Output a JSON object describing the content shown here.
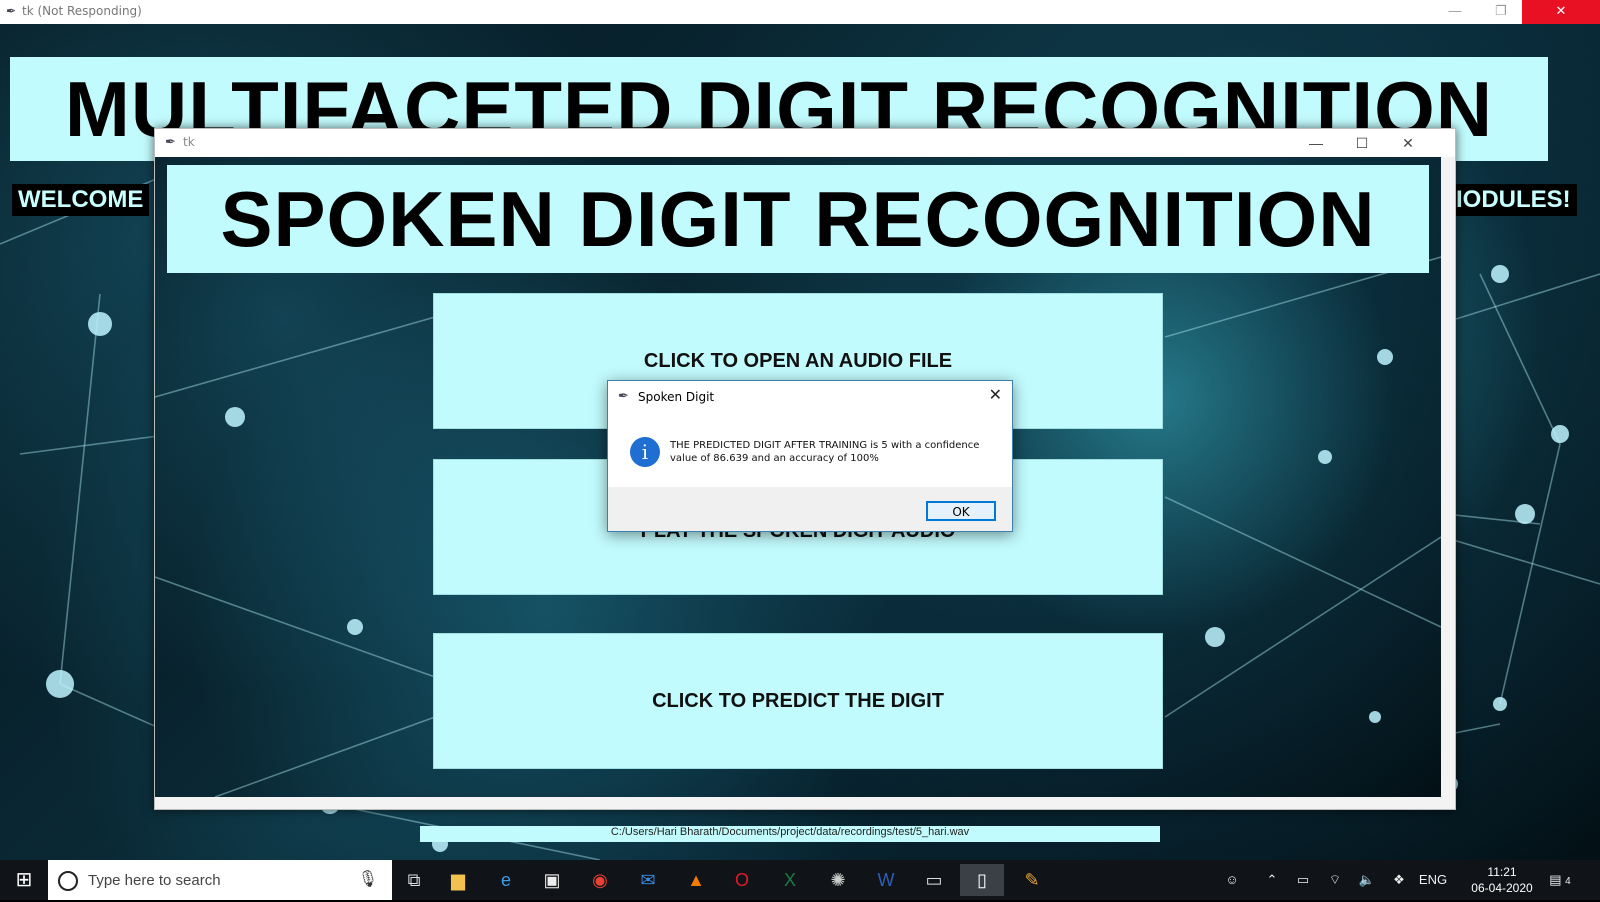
{
  "main_window": {
    "title": "tk (Not Responding)",
    "heading": "MULTIFACETED DIGIT RECOGNITION",
    "welcome_left": "WELCOME",
    "welcome_right": "IODULES!",
    "hidden_path": "C:/Users/Hari Bharath/Documents/project/data/recordings/test/5_hari.wav"
  },
  "tk_window": {
    "title": "tk",
    "heading": "SPOKEN DIGIT RECOGNITION",
    "buttons": {
      "open": "CLICK TO OPEN AN AUDIO FILE",
      "play": "PLAY THE SPOKEN DIGIT AUDIO",
      "predict": "CLICK TO PREDICT THE DIGIT"
    }
  },
  "dialog": {
    "title": "Spoken Digit",
    "message": "THE PREDICTED DIGIT AFTER TRAINING is 5 with a confidence value of 86.639 and an accuracy of 100%",
    "ok_label": "OK"
  },
  "taskbar": {
    "search_placeholder": "Type here to search",
    "language": "ENG",
    "time": "11:21",
    "date": "06-04-2020",
    "notification_count": "4"
  },
  "colors": {
    "panel_cyan": "#c2fbfd",
    "close_red": "#e81123",
    "info_blue": "#1e6fd1"
  }
}
